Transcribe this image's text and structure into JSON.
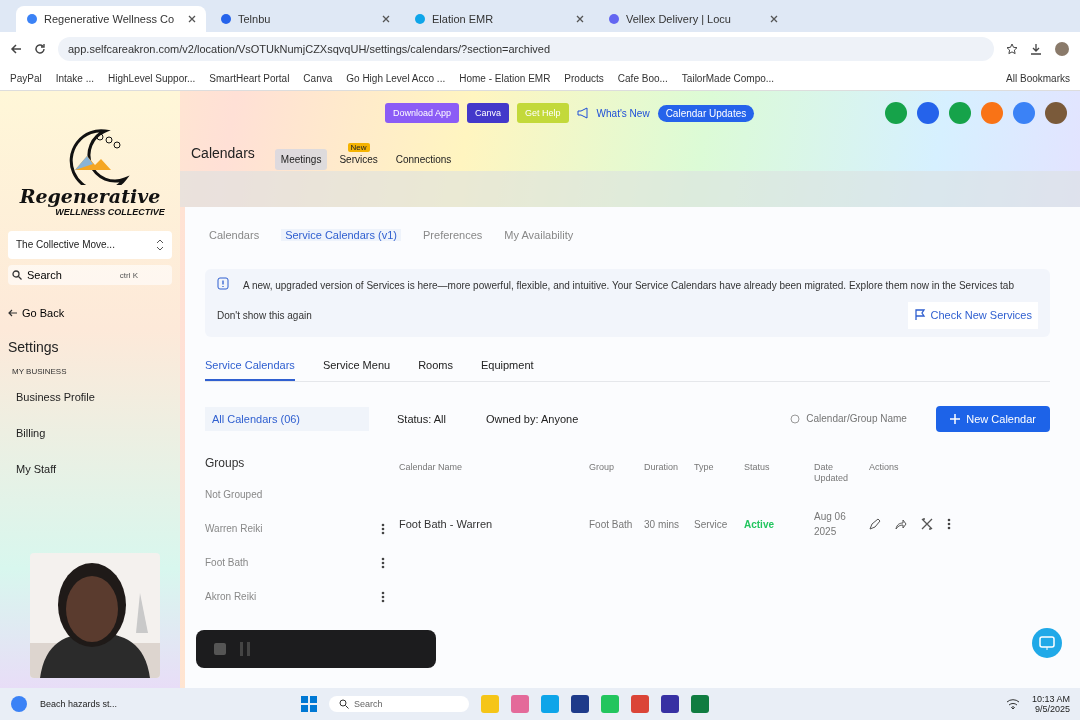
{
  "browser": {
    "tabs": [
      {
        "title": "Regenerative Wellness Co",
        "selected": true
      },
      {
        "title": "Telnbu",
        "selected": false
      },
      {
        "title": "Elation EMR",
        "selected": false
      },
      {
        "title": "Vellex Delivery | Locu",
        "selected": false
      }
    ],
    "url": "app.selfcareakron.com/v2/location/VsOTUkNumjCZXsqvqUH/settings/calendars/?section=archived",
    "bookmarks": [
      "PayPal",
      "Intake ...",
      "HighLevel Suppor...",
      "SmartHeart Portal",
      "Canva",
      "Go High Level Acco ...",
      "Home - Elation EMR",
      "Products",
      "Cafe Boo...",
      "TailorMade Compo..."
    ],
    "all_bookmarks": "All Bookmarks"
  },
  "topbar": {
    "buttons": [
      {
        "label": "Download App",
        "color": "#8b5cf6"
      },
      {
        "label": "Canva",
        "color": "#4338ca"
      },
      {
        "label": "Get Help",
        "color": "#c3d93a"
      }
    ],
    "whats_new": "What's New",
    "updates": "Calendar Updates"
  },
  "sidebar": {
    "brand": {
      "name": "Regenerative",
      "tagline": "WELLNESS COLLECTIVE"
    },
    "location": "The Collective Move...",
    "search": {
      "placeholder": "Search",
      "shortcut": "ctrl K"
    },
    "back": "Go Back",
    "title": "Settings",
    "section": "MY BUSINESS",
    "items": [
      "Business Profile",
      "Billing",
      "My Staff"
    ]
  },
  "header": {
    "title": "Calendars",
    "tabs": [
      {
        "label": "Meetings",
        "selected": true
      },
      {
        "label": "Services",
        "selected": false,
        "badge": "New"
      },
      {
        "label": "Connections",
        "selected": false
      }
    ]
  },
  "subtabs": [
    {
      "label": "Calendars",
      "selected": false
    },
    {
      "label": "Service Calendars (v1)",
      "selected": true
    },
    {
      "label": "Preferences",
      "selected": false
    },
    {
      "label": "My Availability",
      "selected": false
    }
  ],
  "notice": {
    "text": "A new, upgraded version of Services is here—more powerful, flexible, and intuitive. Your Service Calendars have already been migrated. Explore them now in the Services tab",
    "dismiss": "Don't show this again",
    "action": "Check New Services"
  },
  "section_tabs": [
    {
      "label": "Service Calendars",
      "selected": true
    },
    {
      "label": "Service Menu",
      "selected": false
    },
    {
      "label": "Rooms",
      "selected": false
    },
    {
      "label": "Equipment",
      "selected": false
    }
  ],
  "filters": {
    "all": "All Calendars (06)",
    "status": "Status: All",
    "owner": "Owned by: Anyone",
    "search_placeholder": "Calendar/Group Name",
    "new_button": "New Calendar"
  },
  "groups": {
    "title": "Groups",
    "items": [
      "Not Grouped",
      "Warren Reiki",
      "Foot Bath",
      "Akron Reiki"
    ]
  },
  "table": {
    "columns": [
      "Calendar Name",
      "Group",
      "Duration",
      "Type",
      "Status",
      "Date Updated",
      "Actions"
    ],
    "rows": [
      {
        "cells": [
          "Foot Bath - Warren",
          "Foot Bath",
          "30 mins",
          "Service",
          "Active",
          "Aug 06 2025"
        ]
      }
    ]
  },
  "taskbar": {
    "weather": "Beach hazards st...",
    "search_placeholder": "Search",
    "time": "10:13 AM",
    "date": "9/5/2025"
  }
}
